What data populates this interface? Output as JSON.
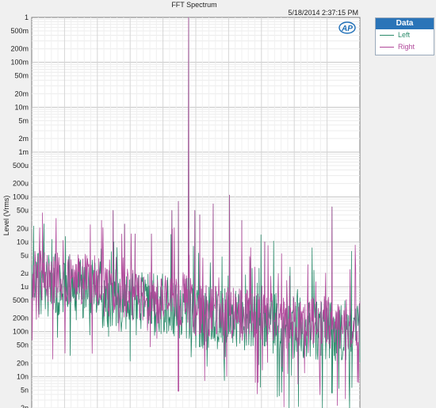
{
  "chart_data": {
    "type": "line",
    "title": "FFT Spectrum",
    "timestamp": "5/18/2014 2:37:15 PM",
    "ylabel": "Level (Vrms)",
    "xlabel": "",
    "yscale": "log",
    "ylim": [
      1.5e-09,
      1
    ],
    "xlim": [
      0,
      1
    ],
    "grid": true,
    "y_ticks": [
      "1",
      "500m",
      "200m",
      "100m",
      "50m",
      "20m",
      "10m",
      "5m",
      "2m",
      "1m",
      "500u",
      "200u",
      "100u",
      "50u",
      "20u",
      "10u",
      "5u",
      "2u",
      "1u",
      "500n",
      "200n",
      "100n",
      "50n",
      "20n",
      "10n",
      "5n",
      "2n"
    ],
    "y_tick_values": [
      1,
      0.5,
      0.2,
      0.1,
      0.05,
      0.02,
      0.01,
      0.005,
      0.002,
      0.001,
      0.0005,
      0.0002,
      0.0001,
      5e-05,
      2e-05,
      1e-05,
      5e-06,
      2e-06,
      1e-06,
      5e-07,
      2e-07,
      1e-07,
      5e-08,
      2e-08,
      1e-08,
      5e-09,
      2e-09
    ],
    "legend_title": "Data",
    "legend_position": "top-right",
    "series": [
      {
        "name": "Left",
        "color": "#2a8a6a"
      },
      {
        "name": "Right",
        "color": "#b0489a"
      }
    ],
    "fundamental": {
      "x": 0.478,
      "value": 1
    },
    "spurs": [
      {
        "x": 0.248,
        "value": 5e-05
      },
      {
        "x": 0.283,
        "value": 2.5e-05
      },
      {
        "x": 0.315,
        "value": 1.5e-05
      },
      {
        "x": 0.365,
        "value": 1.5e-05
      },
      {
        "x": 0.427,
        "value": 5e-05
      },
      {
        "x": 0.447,
        "value": 8e-05
      },
      {
        "x": 0.497,
        "value": 5e-05
      },
      {
        "x": 0.512,
        "value": 4e-05
      },
      {
        "x": 0.553,
        "value": 7e-05
      },
      {
        "x": 0.603,
        "value": 0.00011
      },
      {
        "x": 0.64,
        "value": 3e-05
      },
      {
        "x": 0.71,
        "value": 1e-05
      },
      {
        "x": 0.915,
        "value": 6e-05
      }
    ]
  },
  "logo": "AP"
}
